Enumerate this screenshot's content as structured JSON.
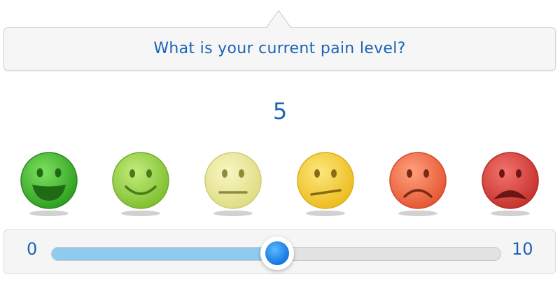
{
  "question": "What is your current pain level?",
  "current_value": "5",
  "slider": {
    "min_label": "0",
    "max_label": "10",
    "value_fraction": 0.5
  },
  "faces": [
    {
      "name": "very-happy-face-icon",
      "color": "#3fb52c",
      "mood": "very-happy"
    },
    {
      "name": "happy-face-icon",
      "color": "#8fcf3f",
      "mood": "happy"
    },
    {
      "name": "neutral-face-icon",
      "color": "#ece99b",
      "mood": "neutral"
    },
    {
      "name": "slightly-unhappy-face-icon",
      "color": "#f6cf34",
      "mood": "slightly-unhappy"
    },
    {
      "name": "sad-face-icon",
      "color": "#ef6b47",
      "mood": "sad"
    },
    {
      "name": "very-sad-face-icon",
      "color": "#d83a35",
      "mood": "very-sad"
    }
  ],
  "colors": {
    "accent_text": "#1b63b4",
    "slider_fill": "#8fcbef",
    "thumb": "#1576e0"
  }
}
